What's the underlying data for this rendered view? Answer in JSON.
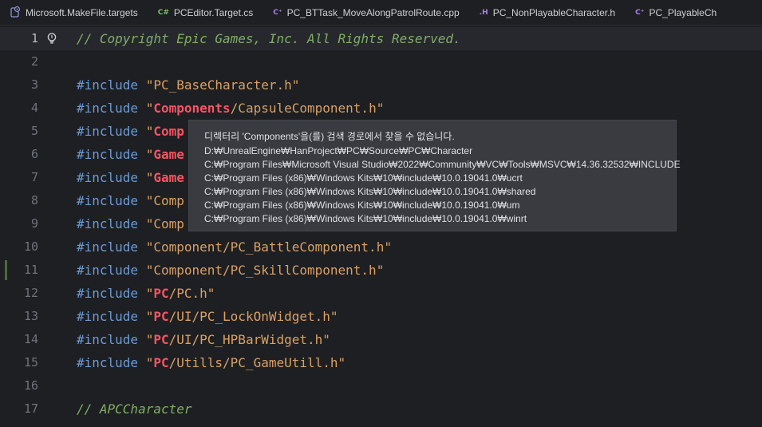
{
  "tabs": [
    {
      "label": "Microsoft.MakeFile.targets",
      "icon": "msbuild-file-icon",
      "badge": "",
      "badge_color": "#8c95d6"
    },
    {
      "label": "PCEditor.Target.cs",
      "icon": "csharp-file-icon",
      "badge": "C#",
      "badge_color": "#7bbf6a"
    },
    {
      "label": "PC_BTTask_MoveAlongPatrolRoute.cpp",
      "icon": "cpp-file-icon",
      "badge": "C⁺",
      "badge_color": "#a783e0"
    },
    {
      "label": "PC_NonPlayableCharacter.h",
      "icon": "header-file-icon",
      "badge": ".H",
      "badge_color": "#a783e0"
    },
    {
      "label": "PC_PlayableCh",
      "icon": "cpp-file-icon",
      "badge": "C⁺",
      "badge_color": "#a783e0"
    }
  ],
  "editor": {
    "active_line": "1",
    "lines": [
      {
        "n": "1",
        "parts": [
          [
            "cmt",
            "// Copyright Epic Games, Inc. All Rights Reserved."
          ]
        ]
      },
      {
        "n": "2",
        "parts": []
      },
      {
        "n": "3",
        "parts": [
          [
            "kw",
            "#include "
          ],
          [
            "strq",
            "\"PC_BaseCharacter.h\""
          ]
        ]
      },
      {
        "n": "4",
        "parts": [
          [
            "kw",
            "#include "
          ],
          [
            "strq",
            "\""
          ],
          [
            "bad",
            "Components"
          ],
          [
            "strq",
            "/CapsuleComponent.h\""
          ]
        ]
      },
      {
        "n": "5",
        "parts": [
          [
            "kw",
            "#include "
          ],
          [
            "strq",
            "\""
          ],
          [
            "bad",
            "Comp"
          ]
        ]
      },
      {
        "n": "6",
        "parts": [
          [
            "kw",
            "#include "
          ],
          [
            "strq",
            "\""
          ],
          [
            "bad",
            "Game"
          ]
        ]
      },
      {
        "n": "7",
        "parts": [
          [
            "kw",
            "#include "
          ],
          [
            "strq",
            "\""
          ],
          [
            "bad",
            "Game"
          ]
        ]
      },
      {
        "n": "8",
        "parts": [
          [
            "kw",
            "#include "
          ],
          [
            "strq",
            "\"Comp"
          ]
        ]
      },
      {
        "n": "9",
        "parts": [
          [
            "kw",
            "#include "
          ],
          [
            "strq",
            "\"Comp"
          ]
        ]
      },
      {
        "n": "10",
        "parts": [
          [
            "kw",
            "#include "
          ],
          [
            "strq",
            "\"Component/PC_BattleComponent.h\""
          ]
        ]
      },
      {
        "n": "11",
        "parts": [
          [
            "kw",
            "#include "
          ],
          [
            "strq",
            "\"Component/PC_SkillComponent.h\""
          ]
        ]
      },
      {
        "n": "12",
        "parts": [
          [
            "kw",
            "#include "
          ],
          [
            "strq",
            "\""
          ],
          [
            "bad",
            "PC"
          ],
          [
            "strq",
            "/PC.h\""
          ]
        ]
      },
      {
        "n": "13",
        "parts": [
          [
            "kw",
            "#include "
          ],
          [
            "strq",
            "\""
          ],
          [
            "bad",
            "PC"
          ],
          [
            "strq",
            "/UI/PC_LockOnWidget.h\""
          ]
        ]
      },
      {
        "n": "14",
        "parts": [
          [
            "kw",
            "#include "
          ],
          [
            "strq",
            "\""
          ],
          [
            "bad",
            "PC"
          ],
          [
            "strq",
            "/UI/PC_HPBarWidget.h\""
          ]
        ]
      },
      {
        "n": "15",
        "parts": [
          [
            "kw",
            "#include "
          ],
          [
            "strq",
            "\""
          ],
          [
            "bad",
            "PC"
          ],
          [
            "strq",
            "/Utills/PC_GameUtill.h\""
          ]
        ]
      },
      {
        "n": "16",
        "parts": []
      },
      {
        "n": "17",
        "parts": [
          [
            "cmt",
            "// APCCharacter"
          ]
        ]
      }
    ]
  },
  "tooltip": {
    "title": "디렉터리 'Components'을(를) 검색 경로에서 찾을 수 없습니다.",
    "paths": [
      "D:₩UnrealEngine₩HanProject₩PC₩Source₩PC₩Character",
      "C:₩Program Files₩Microsoft Visual Studio₩2022₩Community₩VC₩Tools₩MSVC₩14.36.32532₩INCLUDE",
      "C:₩Program Files (x86)₩Windows Kits₩10₩include₩10.0.19041.0₩ucrt",
      "C:₩Program Files (x86)₩Windows Kits₩10₩include₩10.0.19041.0₩shared",
      "C:₩Program Files (x86)₩Windows Kits₩10₩include₩10.0.19041.0₩um",
      "C:₩Program Files (x86)₩Windows Kits₩10₩include₩10.0.19041.0₩winrt"
    ]
  },
  "colors": {
    "background": "#1e1f22",
    "keyword": "#6b9bd6",
    "string": "#d9a065",
    "error": "#f75464",
    "comment": "#7fae64",
    "tooltip_bg": "#393b40"
  }
}
